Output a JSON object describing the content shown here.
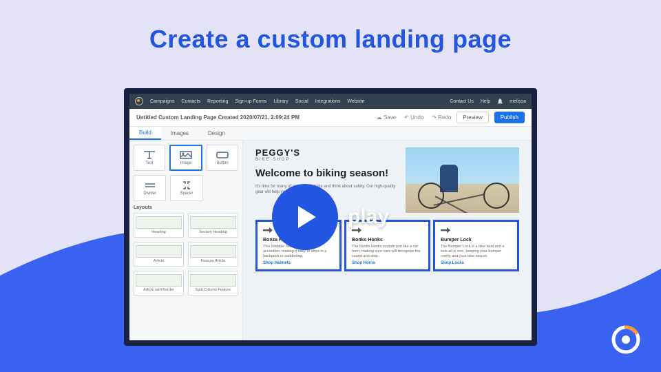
{
  "hero": {
    "title": "Create a custom landing page",
    "play_label": "play"
  },
  "topbar": {
    "nav": [
      "Campaigns",
      "Contacts",
      "Reporting",
      "Sign-up Forms",
      "Library",
      "Social",
      "Integrations",
      "Website"
    ],
    "right": {
      "contact": "Contact Us",
      "help": "Help",
      "user": "melissa"
    }
  },
  "docbar": {
    "title": "Untitled Custom Landing Page Created 2020/07/21, 2:09:24 PM",
    "save": "Save",
    "undo": "Undo",
    "redo": "Redo",
    "preview": "Preview",
    "publish": "Publish"
  },
  "tabs": [
    "Build",
    "Images",
    "Design"
  ],
  "blocks": [
    [
      "Text",
      "Image",
      "Button"
    ],
    [
      "Divider",
      "Spacer",
      ""
    ]
  ],
  "layouts_header": "Layouts",
  "layouts": [
    [
      "Heading",
      "Section Heading"
    ],
    [
      "Article",
      "Feature Article"
    ],
    [
      "Article with Border",
      "Split Column Feature"
    ]
  ],
  "page": {
    "brand": "PEGGY'S",
    "brand_sub": "BIKE SHOP",
    "welcome": "Welcome to biking season!",
    "blurb": "It's time for many of us to get outside and think about safety. Our high-quality gear will help you stay safe!"
  },
  "cards": [
    {
      "title": "Bonza Helmet",
      "body": "This foldable helmet acts like an accordion, making it easy to store in a backpack or saddlebag.",
      "cta": "Shop Helmets"
    },
    {
      "title": "Bonks Honks",
      "body": "The Bonks Honks sounds just like a car horn, making sure cars will recognize the sound and stop.",
      "cta": "Shop Horns"
    },
    {
      "title": "Bumper Lock",
      "body": "The Bumper Lock is a bike seat and a lock all in one, keeping your bumper comfy and your bike secure.",
      "cta": "Shop Locks"
    }
  ]
}
